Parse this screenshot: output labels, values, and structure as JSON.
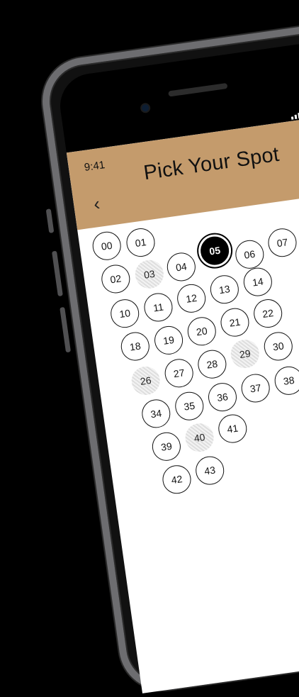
{
  "status_bar": {
    "time": "9:41"
  },
  "header": {
    "title": "Pick Your Spot",
    "back_icon": "chevron-left-icon"
  },
  "colors": {
    "header_bg": "#c49b6c",
    "selected": "#000000",
    "taken_pattern": "#dedede"
  },
  "spots": [
    {
      "label": "00",
      "state": "available"
    },
    {
      "label": "01",
      "state": "available"
    },
    {
      "label": "02",
      "state": "available"
    },
    {
      "label": "03",
      "state": "taken"
    },
    {
      "label": "04",
      "state": "available"
    },
    {
      "label": "05",
      "state": "selected"
    },
    {
      "label": "06",
      "state": "available"
    },
    {
      "label": "07",
      "state": "available"
    },
    {
      "label": "10",
      "state": "available"
    },
    {
      "label": "11",
      "state": "available"
    },
    {
      "label": "12",
      "state": "available"
    },
    {
      "label": "13",
      "state": "available"
    },
    {
      "label": "14",
      "state": "available"
    },
    {
      "label": "18",
      "state": "available"
    },
    {
      "label": "19",
      "state": "available"
    },
    {
      "label": "20",
      "state": "available"
    },
    {
      "label": "21",
      "state": "available"
    },
    {
      "label": "22",
      "state": "available"
    },
    {
      "label": "26",
      "state": "taken"
    },
    {
      "label": "27",
      "state": "available"
    },
    {
      "label": "28",
      "state": "available"
    },
    {
      "label": "29",
      "state": "taken"
    },
    {
      "label": "30",
      "state": "available"
    },
    {
      "label": "34",
      "state": "available"
    },
    {
      "label": "35",
      "state": "available"
    },
    {
      "label": "36",
      "state": "available"
    },
    {
      "label": "37",
      "state": "available"
    },
    {
      "label": "38",
      "state": "available"
    },
    {
      "label": "39",
      "state": "available"
    },
    {
      "label": "40",
      "state": "taken"
    },
    {
      "label": "41",
      "state": "available"
    },
    {
      "label": "42",
      "state": "available"
    },
    {
      "label": "43",
      "state": "available"
    }
  ]
}
